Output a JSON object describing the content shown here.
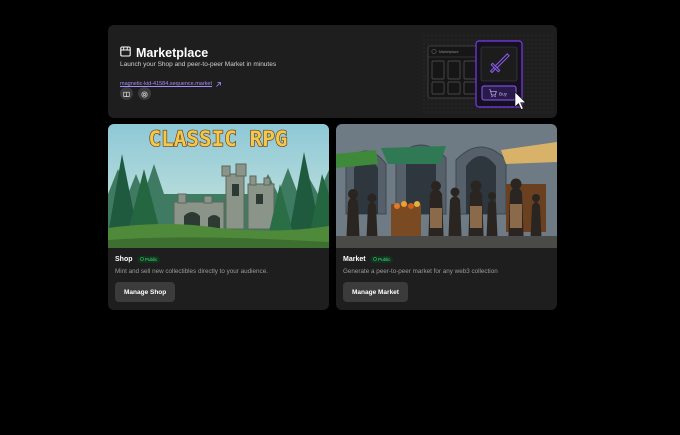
{
  "header": {
    "title": "Marketplace",
    "subtitle": "Launch your Shop and peer-to-peer Market in minutes",
    "link": "magnetic-kid-41584.sequence.market",
    "illustration": {
      "window_label": "Marketplace",
      "buy_label": "Buy"
    },
    "icons": [
      "marketplace-icon",
      "external-link-icon",
      "docs-icon",
      "globe-icon"
    ]
  },
  "cards": [
    {
      "image_title": "CLASSIC RPG",
      "name": "Shop",
      "badge": "Public",
      "description": "Mint and sell new collectibles directly to your audience.",
      "button": "Manage Shop"
    },
    {
      "name": "Market",
      "badge": "Public",
      "description": "Generate a peer-to-peer market for any web3 collection",
      "button": "Manage Market"
    }
  ],
  "colors": {
    "background": "#000000",
    "card": "#1e1e1e",
    "accent": "#8b5cf6",
    "link": "#a78bfa",
    "badge_text": "#4ade80"
  }
}
